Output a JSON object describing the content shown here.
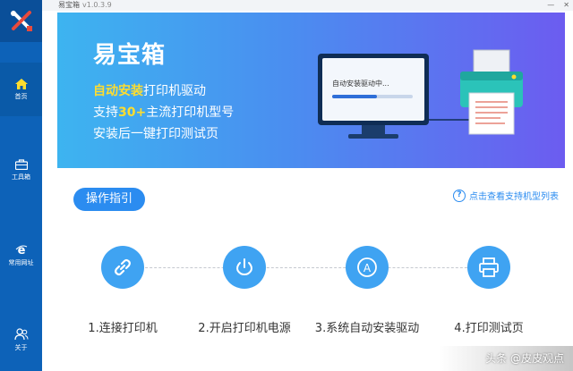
{
  "colors": {
    "sidebar": "#0d62b8",
    "accent": "#2b8cf0",
    "step_circle": "#3fa3f2",
    "highlight": "#ffdd2e"
  },
  "window": {
    "title": "易宝箱",
    "version": "v1.0.3.9"
  },
  "sidebar": {
    "items": [
      {
        "label": "首页",
        "icon": "home-icon",
        "active": true
      },
      {
        "label": "工具箱",
        "icon": "toolbox-icon",
        "active": false
      },
      {
        "label": "常用网址",
        "icon": "ie-browser-icon",
        "active": false
      },
      {
        "label": "关于",
        "icon": "users-icon",
        "active": false
      }
    ]
  },
  "banner": {
    "title": "易宝箱",
    "features": [
      {
        "highlight": "自动安装",
        "rest": "打印机驱动"
      },
      {
        "pre": "支持",
        "highlight": "30+",
        "rest": "主流打印机型号"
      },
      {
        "pre": "安装后一键打印测试页"
      }
    ],
    "monitor_status": "自动安装驱动中...",
    "install_progress": 0.55
  },
  "guide": {
    "button_label": "操作指引",
    "supported_link": "点击查看支持机型列表"
  },
  "steps": [
    {
      "label": "1.连接打印机",
      "icon": "link-icon"
    },
    {
      "label": "2.开启打印机电源",
      "icon": "power-icon"
    },
    {
      "label": "3.系统自动安装驱动",
      "icon": "auto-install-icon"
    },
    {
      "label": "4.打印测试页",
      "icon": "printer-icon"
    }
  ],
  "watermark": "头条 @皮皮观点"
}
